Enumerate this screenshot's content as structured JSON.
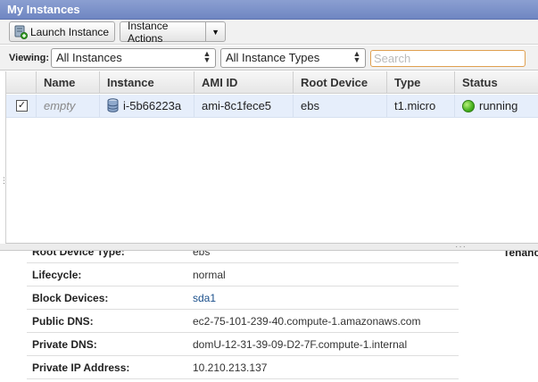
{
  "window": {
    "title": "My Instances"
  },
  "toolbar": {
    "launch_label": "Launch Instance",
    "actions_label": "Instance Actions"
  },
  "filters": {
    "viewing_label": "Viewing:",
    "instances_select": "All Instances",
    "types_select": "All Instance Types",
    "search_placeholder": "Search"
  },
  "grid": {
    "columns": [
      "Name",
      "Instance",
      "AMI ID",
      "Root Device",
      "Type",
      "Status"
    ],
    "rows": [
      {
        "selected": true,
        "checkmark": "✓",
        "name": "empty",
        "instance": "i-5b66223a",
        "ami_id": "ami-8c1fece5",
        "root_device": "ebs",
        "type": "t1.micro",
        "status": "running",
        "status_color": "#46b21e"
      }
    ]
  },
  "details": {
    "partial_top_label": "Root Device Type:",
    "partial_top_value": "ebs",
    "partial_right_label": "Tenancy",
    "rows": [
      {
        "label": "Lifecycle:",
        "value": "normal"
      },
      {
        "label": "Block Devices:",
        "value": "sda1"
      },
      {
        "label": "Public DNS:",
        "value": "ec2-75-101-239-40.compute-1.amazonaws.com"
      },
      {
        "label": "Private DNS:",
        "value": "domU-12-31-39-09-D2-7F.compute-1.internal"
      },
      {
        "label": "Private IP Address:",
        "value": "10.210.213.137"
      }
    ]
  },
  "colors": {
    "titlebar": "#7a90c8",
    "row_selected": "#e6eefb",
    "link": "#1a4f8b",
    "search_border": "#e0a050"
  }
}
